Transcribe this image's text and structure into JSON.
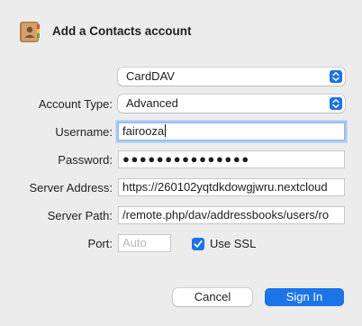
{
  "header": {
    "title": "Add a Contacts account",
    "icon": "contacts-app-icon"
  },
  "type_popup": {
    "value": "CardDAV"
  },
  "account_type": {
    "label": "Account Type:",
    "value": "Advanced"
  },
  "username": {
    "label": "Username:",
    "value": "fairooza"
  },
  "password": {
    "label": "Password:",
    "masked_value": "●●●●●●●●●●●●●●●"
  },
  "server_address": {
    "label": "Server Address:",
    "value": "https://260102yqtdkdowgjwru.nextcloud"
  },
  "server_path": {
    "label": "Server Path:",
    "value": "/remote.php/dav/addressbooks/users/ro"
  },
  "port": {
    "label": "Port:",
    "placeholder": "Auto",
    "value": ""
  },
  "use_ssl": {
    "label": "Use SSL",
    "checked": true
  },
  "buttons": {
    "cancel": "Cancel",
    "sign_in": "Sign In"
  },
  "colors": {
    "accent": "#1a73e8",
    "background": "#ececec",
    "focus_ring": "#a7c8f5"
  }
}
